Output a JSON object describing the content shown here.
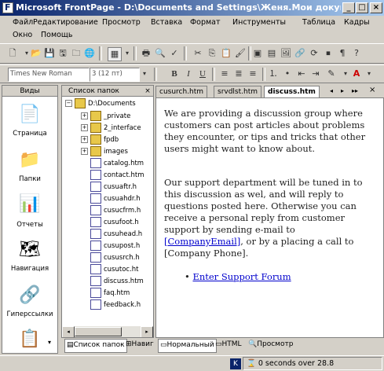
{
  "window": {
    "title": "Microsoft FrontPage - D:\\Documents and Settings\\Женя.Мои документы\\Мои..."
  },
  "menu": {
    "row1": [
      "Файл",
      "Редактирование",
      "Просмотр",
      "Вставка",
      "Формат",
      "Инструменты",
      "Таблица",
      "Кадры"
    ],
    "row2": [
      "Окно",
      "Помощь"
    ]
  },
  "toolbar": {
    "font": "Times New Roman",
    "size": "3 (12 пт)",
    "bold": "B",
    "italic": "I",
    "underline": "U"
  },
  "views": {
    "header": "Виды",
    "items": [
      {
        "label": "Страница",
        "icon": "page-view-icon"
      },
      {
        "label": "Папки",
        "icon": "folder-view-icon"
      },
      {
        "label": "Отчеты",
        "icon": "reports-view-icon"
      },
      {
        "label": "Навигация",
        "icon": "navigation-view-icon"
      },
      {
        "label": "Гиперссылки",
        "icon": "hyperlinks-view-icon"
      }
    ]
  },
  "folders": {
    "header": "Список папок",
    "root": "D:\\Documents",
    "items": [
      "_private",
      "2_interface",
      "fpdb",
      "images",
      "catalog.htm",
      "contact.htm",
      "cusuaftr.h",
      "cusuahdr.h",
      "cusucfrm.h",
      "cusufoot.h",
      "cusuhead.h",
      "cusupost.h",
      "cususrch.h",
      "cusutoc.ht",
      "discuss.htm",
      "faq.htm",
      "feedback.h"
    ]
  },
  "doctabs": [
    "cusurch.htm",
    "srvdlst.htm",
    "discuss.htm"
  ],
  "editor": {
    "para1": "We are providing a discussion group where customers can post articles about problems they encounter, or tips and tricks that other users might want to know about.",
    "para2a": "Our support department will be tuned in to this discussion as wel, and will reply to questions posted here. Otherwise you can receive a personal reply from customer support by sending e-mail to ",
    "para2link": "[CompanyEmail]",
    "para2b": ", or by a placing a call to [Company Phone].",
    "bullet": "Enter Support Forum"
  },
  "bottomtabs": {
    "folderlist": "Список папок",
    "nav": "Навиг",
    "normal": "Нормальный",
    "html": "HTML",
    "preview": "Просмотр"
  },
  "status": {
    "speed": "0 seconds over 28.8"
  }
}
